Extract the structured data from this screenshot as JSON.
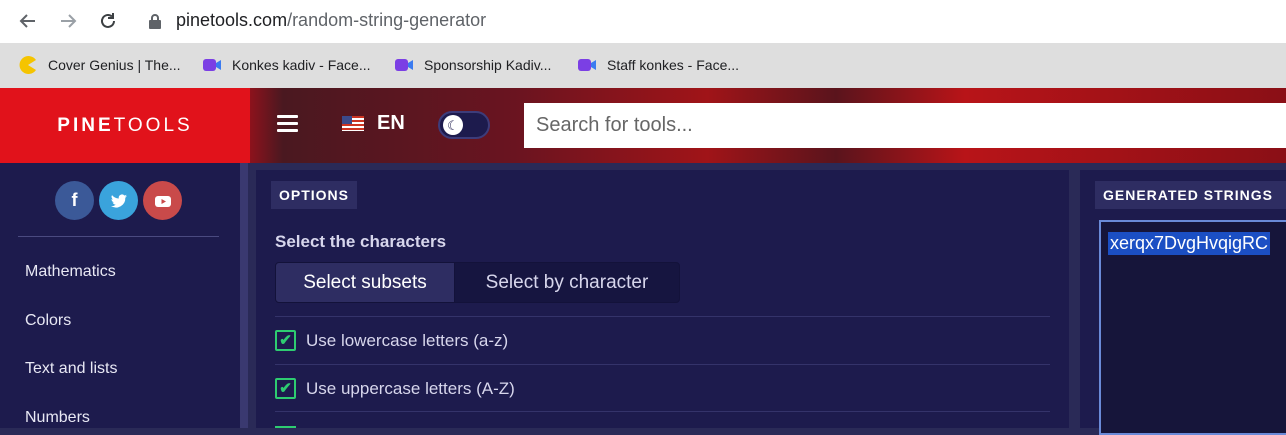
{
  "browser": {
    "url_domain": "pinetools.com",
    "url_path": "/random-string-generator",
    "bookmarks": [
      {
        "label": "Cover Genius | The...",
        "icon": "pacman-icon"
      },
      {
        "label": "Konkes kadiv - Face...",
        "icon": "video-call-icon"
      },
      {
        "label": "Sponsorship Kadiv...",
        "icon": "video-call-icon"
      },
      {
        "label": "Staff konkes - Face...",
        "icon": "video-call-icon"
      }
    ]
  },
  "header": {
    "logo_bold": "PINE",
    "logo_thin": "TOOLS",
    "language": "EN",
    "search_placeholder": "Search for tools..."
  },
  "sidebar": {
    "social": [
      {
        "icon": "facebook-icon",
        "glyph": "f",
        "color": "#3b5998"
      },
      {
        "icon": "twitter-icon",
        "glyph": "t",
        "color": "#3aa3dc"
      },
      {
        "icon": "youtube-icon",
        "glyph": "▶",
        "color": "#c94a4a"
      }
    ],
    "items": [
      {
        "label": "Mathematics"
      },
      {
        "label": "Colors"
      },
      {
        "label": "Text and lists"
      },
      {
        "label": "Numbers"
      }
    ]
  },
  "options": {
    "title": "OPTIONS",
    "select_label": "Select the characters",
    "tabs": [
      {
        "label": "Select subsets",
        "active": true
      },
      {
        "label": "Select by character",
        "active": false
      }
    ],
    "checkboxes": [
      {
        "label": "Use lowercase letters (a-z)",
        "checked": true
      },
      {
        "label": "Use uppercase letters (A-Z)",
        "checked": true
      }
    ]
  },
  "generated": {
    "title": "GENERATED STRINGS",
    "first_string": "xerqx7DvgHvqigRC"
  },
  "colors": {
    "brand_red": "#e1121b",
    "panel_bg": "#1d1b4d",
    "check_green": "#2ecc71"
  }
}
